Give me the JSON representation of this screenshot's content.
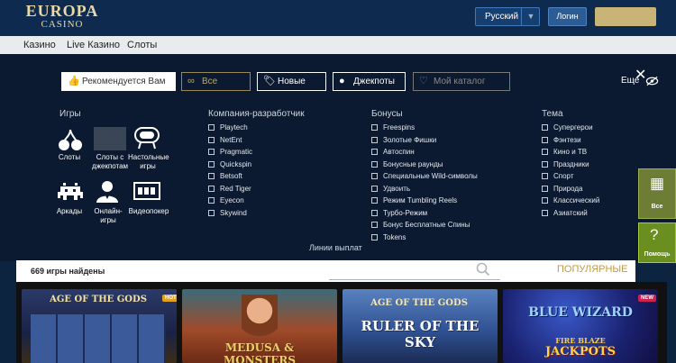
{
  "header": {
    "logo_top": "EUROPA",
    "logo_bottom": "CASINO",
    "language": "Русский",
    "login_label": "Логин"
  },
  "nav": {
    "items": [
      "Казино",
      "Live Казино",
      "Слоты"
    ]
  },
  "filters": {
    "buttons": [
      {
        "label": "Рекомендуется Вам",
        "icon": "thumbs-up-icon"
      },
      {
        "label": "Все",
        "icon": "infinity-icon"
      },
      {
        "label": "Новые",
        "icon": "tag-icon"
      },
      {
        "label": "Джекпоты",
        "icon": "bomb-icon"
      },
      {
        "label": "Мой каталог",
        "icon": "heart-icon"
      }
    ],
    "more_label": "Еще",
    "games": {
      "title": "Игры",
      "items": [
        "Слоты",
        "Слоты с джекпотам",
        "Настольные игры",
        "Аркады",
        "Онлайн-игры",
        "Видеопокер"
      ]
    },
    "providers": {
      "title": "Компания-разработчик",
      "items": [
        "Playtech",
        "NetEnt",
        "Pragmatic",
        "Quickspin",
        "Betsoft",
        "Red Tiger",
        "Eyecon",
        "Skywind"
      ]
    },
    "bonuses": {
      "title": "Бонусы",
      "items": [
        "Freespins",
        "Золотые Фишки",
        "Автоспин",
        "Бонусные раунды",
        "Специальные Wild-символы",
        "Удвоить",
        "Режим Tumbling Reels",
        "Турбо-Режим",
        "Бонус Бесплатные Спины",
        "Tokens"
      ]
    },
    "themes": {
      "title": "Тема",
      "items": [
        "Супергерои",
        "Фэнтези",
        "Кино и ТВ",
        "Праздники",
        "Спорт",
        "Природа",
        "Классический",
        "Азиатский"
      ]
    },
    "paylines_label": "Линии выплат"
  },
  "sidebar": {
    "all_label": "Все",
    "help_label": "Помощь"
  },
  "results": {
    "count_label": "669 игры найдены",
    "sort_label": "ПОПУЛЯРНЫЕ"
  },
  "games": [
    {
      "title": "AGE OF THE GODS",
      "badge": "HOT",
      "badge_color": "#e0a020"
    },
    {
      "title": "MEDUSA & MONSTERS",
      "badge": "",
      "badge_color": ""
    },
    {
      "title_top": "AGE OF THE GODS",
      "title": "RULER OF THE SKY",
      "badge": "",
      "badge_color": ""
    },
    {
      "title": "BLUE WIZARD",
      "subtitle": "FIRE BLAZE",
      "subtitle2": "JACKPOTS",
      "badge": "NEW",
      "badge_color": "#d02050"
    }
  ],
  "colors": {
    "header_bg": "#0e2b4f",
    "filters_bg": "#0b1a30",
    "gold": "#c29b3d",
    "side_green": "#6a8e1f"
  }
}
